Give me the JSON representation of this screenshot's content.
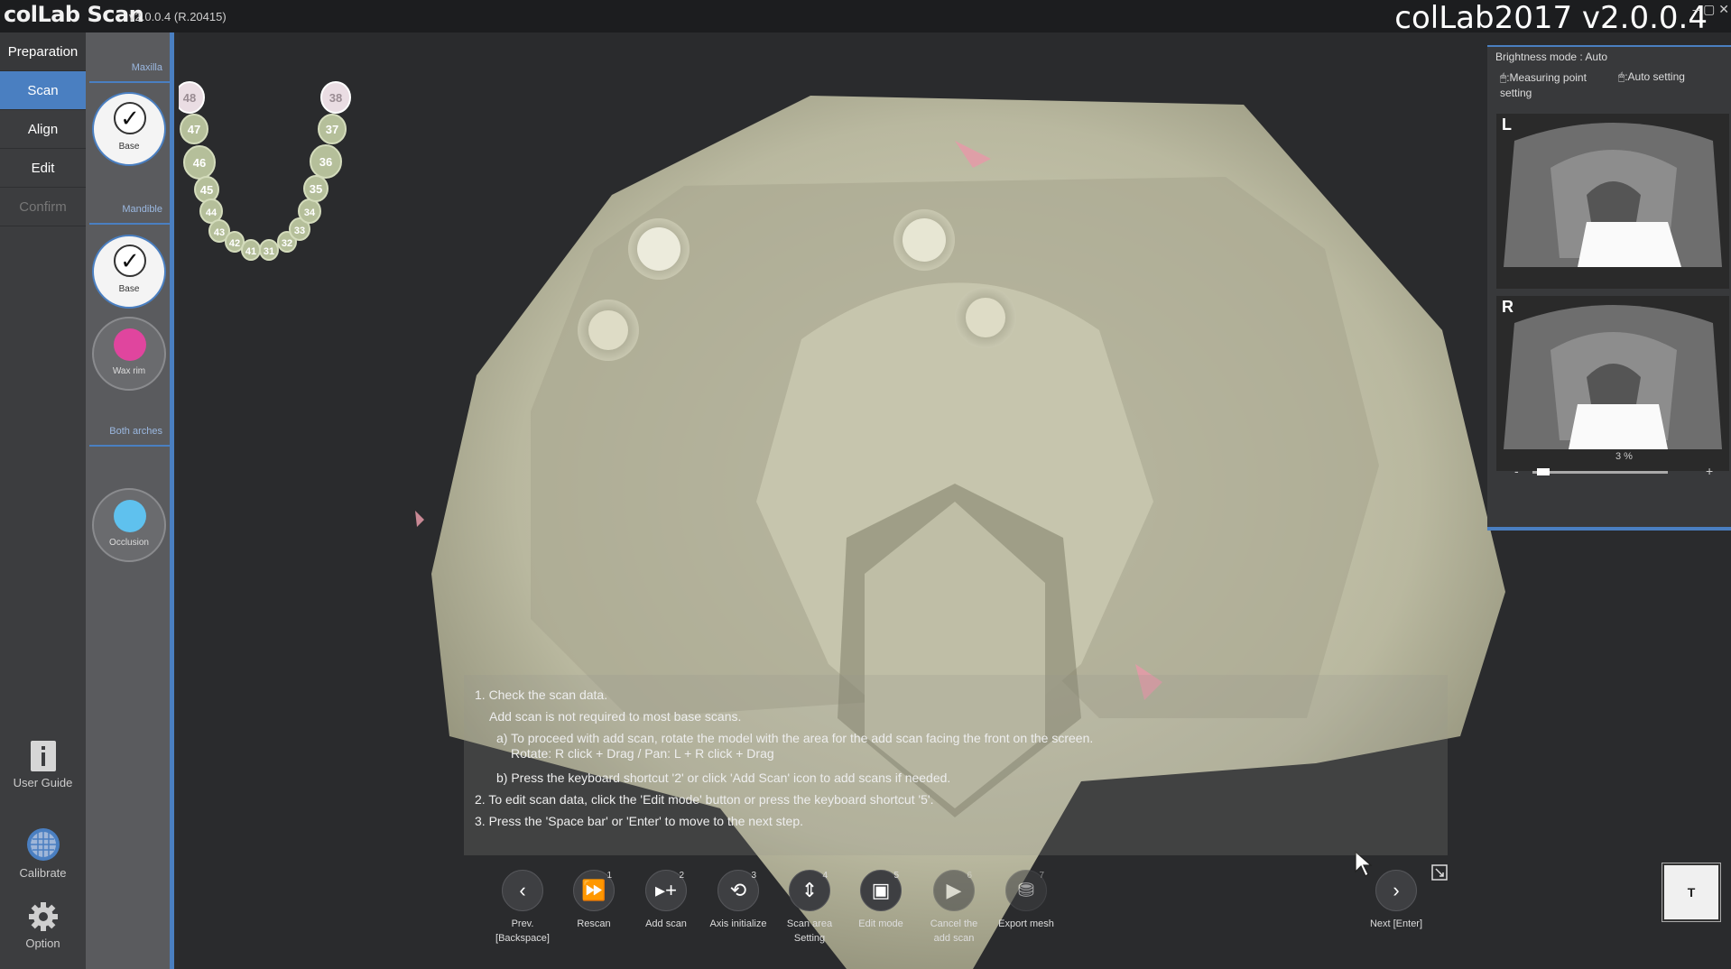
{
  "titlebar": {
    "app_name": "colLab Scan",
    "version": "v2.0.0.4 (R.20415)",
    "big_title": "colLab2017 v2.0.0.4",
    "window_controls": "‒ ▢ ✕"
  },
  "nav": {
    "items": [
      {
        "label": "Preparation",
        "state": "header"
      },
      {
        "label": "Scan",
        "state": "active"
      },
      {
        "label": "Align",
        "state": "normal"
      },
      {
        "label": "Edit",
        "state": "normal"
      },
      {
        "label": "Confirm",
        "state": "disabled"
      }
    ],
    "user_guide": "User Guide",
    "calibrate": "Calibrate",
    "option": "Option"
  },
  "steps": {
    "maxilla_label": "Maxilla",
    "mandible_label": "Mandible",
    "both_label": "Both arches",
    "maxilla_base": "Base",
    "mandible_base": "Base",
    "wax_rim": "Wax rim",
    "occlusion": "Occlusion",
    "colors": {
      "wax_rim": "#e0459e",
      "occlusion": "#5fc1ee"
    }
  },
  "tooth_chart": {
    "teeth": [
      "48",
      "47",
      "46",
      "45",
      "44",
      "43",
      "42",
      "41",
      "31",
      "32",
      "33",
      "34",
      "35",
      "36",
      "37",
      "38"
    ],
    "missing": [
      "48",
      "38"
    ]
  },
  "instructions": {
    "line1": "1. Check the scan data.",
    "line1a": "Add scan is not required to most base scans.",
    "line1b": "a) To proceed with add scan, rotate the model with the area for the add scan facing the front on the screen.",
    "line1b2": "Rotate: R click + Drag / Pan: L + R click + Drag",
    "line1c": "b) Press the keyboard shortcut '2' or click 'Add Scan' icon to add scans if needed.",
    "line2": "2. To edit scan data, click the 'Edit mode' button or press the keyboard shortcut '5'.",
    "line3": "3. Press the 'Space bar' or 'Enter' to move to the next step."
  },
  "brightness": {
    "title": "Brightness mode : Auto",
    "opt1": ":Measuring point setting",
    "opt2": ":Auto setting",
    "left_label": "L",
    "right_label": "R",
    "level": "3 %",
    "minus": "-",
    "plus": "+",
    "level_value": 3
  },
  "toolbar": {
    "prev": "Prev. [Backspace]",
    "rescan": "Rescan",
    "rescan_key": "1",
    "add_scan": "Add scan",
    "add_scan_key": "2",
    "axis": "Axis initialize",
    "axis_key": "3",
    "scan_area": "Scan area Setting",
    "scan_area_key": "4",
    "edit_mode": "Edit mode",
    "edit_mode_key": "5",
    "cancel_add": "Cancel the add scan",
    "cancel_add_key": "6",
    "export_mesh": "Export mesh",
    "export_mesh_key": "7",
    "next": "Next [Enter]",
    "t_button": "T"
  }
}
